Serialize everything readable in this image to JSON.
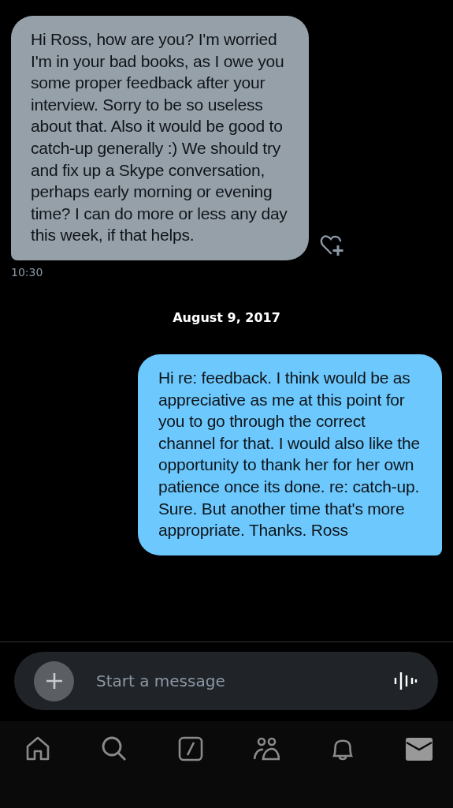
{
  "messages": [
    {
      "kind": "received",
      "text": "Hi Ross, how are you? I'm worried I'm in your bad books, as I owe you some proper feedback after your interview. Sorry to be so useless about that. Also it would be good to catch-up generally :) We should try and fix up a Skype conversation, perhaps early morning or evening time? I can do more or less any day this week, if that helps.",
      "time": "10:30"
    },
    {
      "kind": "date",
      "text": "August 9, 2017"
    },
    {
      "kind": "sent",
      "text": "Hi re: feedback. I think would be as appreciative as me at this point for you to go through the correct channel for that. I would also like the opportunity to thank her for her own patience once its done. re: catch-up. Sure. But another time that's more appropriate. Thanks. Ross"
    }
  ],
  "composer": {
    "placeholder": "Start a message"
  },
  "nav": [
    {
      "kind": "home",
      "selected": false
    },
    {
      "kind": "search",
      "selected": false
    },
    {
      "kind": "compose",
      "selected": false
    },
    {
      "kind": "people",
      "selected": false
    },
    {
      "kind": "bell",
      "selected": false
    },
    {
      "kind": "mail",
      "selected": true
    }
  ]
}
